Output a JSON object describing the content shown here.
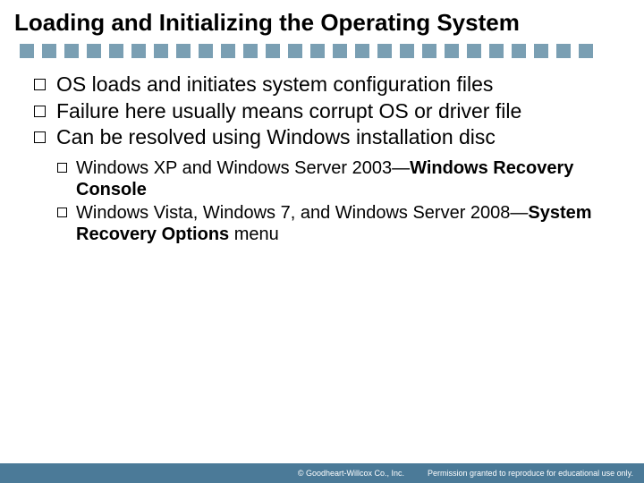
{
  "title": "Loading and Initializing the Operating System",
  "decorativeSquareCount": 26,
  "bullets": [
    {
      "text": "OS loads and initiates system configuration files"
    },
    {
      "text": "Failure here usually means corrupt OS or driver file"
    },
    {
      "text": "Can be resolved using Windows installation disc"
    }
  ],
  "subBullets": [
    {
      "prefix": "Windows XP and Windows Server 2003—",
      "emph": "Windows Recovery Console",
      "suffix": ""
    },
    {
      "prefix": "Windows Vista, Windows 7, and Windows Server 2008—",
      "emph": "System Recovery Options",
      "suffix": " menu"
    }
  ],
  "footer": {
    "copyright": "© Goodheart-Willcox Co., Inc.",
    "permission": "Permission granted to reproduce for educational use only."
  }
}
